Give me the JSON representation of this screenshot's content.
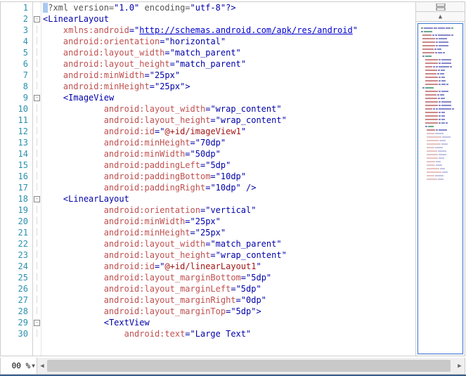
{
  "zoom": "00 %",
  "footer_tip": "",
  "lines": [
    {
      "n": 1,
      "fold": "",
      "ind": 0,
      "tokens": [
        [
          "tag",
          "<"
        ],
        [
          "pi",
          "?xml version="
        ],
        [
          "str",
          "\"1.0\""
        ],
        [
          "pi",
          " encoding="
        ],
        [
          "str",
          "\"utf-8\""
        ],
        [
          "tag",
          "?>"
        ]
      ]
    },
    {
      "n": 2,
      "fold": "box",
      "ind": 0,
      "tokens": [
        [
          "brk",
          "<"
        ],
        [
          "tag",
          "LinearLayout"
        ]
      ]
    },
    {
      "n": 3,
      "fold": "line",
      "ind": 1,
      "tokens": [
        [
          "attr",
          "xmlns:android"
        ],
        [
          "brk",
          "="
        ],
        [
          "str",
          "\""
        ],
        [
          "url",
          "http://schemas.android.com/apk/res/android"
        ],
        [
          "str",
          "\""
        ]
      ]
    },
    {
      "n": 4,
      "fold": "line",
      "ind": 1,
      "tokens": [
        [
          "attr",
          "android:orientation"
        ],
        [
          "brk",
          "="
        ],
        [
          "str",
          "\"horizontal\""
        ]
      ]
    },
    {
      "n": 5,
      "fold": "line",
      "ind": 1,
      "tokens": [
        [
          "attr",
          "android:layout_width"
        ],
        [
          "brk",
          "="
        ],
        [
          "str",
          "\"match_parent\""
        ]
      ]
    },
    {
      "n": 6,
      "fold": "line",
      "ind": 1,
      "tokens": [
        [
          "attr",
          "android:layout_height"
        ],
        [
          "brk",
          "="
        ],
        [
          "str",
          "\"match_parent\""
        ]
      ]
    },
    {
      "n": 7,
      "fold": "line",
      "ind": 1,
      "tokens": [
        [
          "attr",
          "android:minWidth"
        ],
        [
          "brk",
          "="
        ],
        [
          "str",
          "\"25px\""
        ]
      ]
    },
    {
      "n": 8,
      "fold": "line",
      "ind": 1,
      "tokens": [
        [
          "attr",
          "android:minHeight"
        ],
        [
          "brk",
          "="
        ],
        [
          "str",
          "\"25px\""
        ],
        [
          "brk",
          ">"
        ]
      ]
    },
    {
      "n": 9,
      "fold": "box",
      "ind": 1,
      "tokens": [
        [
          "brk",
          "<"
        ],
        [
          "tag",
          "ImageView"
        ]
      ]
    },
    {
      "n": 10,
      "fold": "line",
      "ind": 3,
      "tokens": [
        [
          "attr",
          "android:layout_width"
        ],
        [
          "brk",
          "="
        ],
        [
          "str",
          "\"wrap_content\""
        ]
      ]
    },
    {
      "n": 11,
      "fold": "line",
      "ind": 3,
      "tokens": [
        [
          "attr",
          "android:layout_height"
        ],
        [
          "brk",
          "="
        ],
        [
          "str",
          "\"wrap_content\""
        ]
      ]
    },
    {
      "n": 12,
      "fold": "line",
      "ind": 3,
      "tokens": [
        [
          "attr",
          "android:id"
        ],
        [
          "brk",
          "="
        ],
        [
          "str",
          "\""
        ],
        [
          "id",
          "@+id/imageView1"
        ],
        [
          "str",
          "\""
        ]
      ]
    },
    {
      "n": 13,
      "fold": "line",
      "ind": 3,
      "tokens": [
        [
          "attr",
          "android:minHeight"
        ],
        [
          "brk",
          "="
        ],
        [
          "str",
          "\"70dp\""
        ]
      ]
    },
    {
      "n": 14,
      "fold": "line",
      "ind": 3,
      "tokens": [
        [
          "attr",
          "android:minWidth"
        ],
        [
          "brk",
          "="
        ],
        [
          "str",
          "\"50dp\""
        ]
      ]
    },
    {
      "n": 15,
      "fold": "line",
      "ind": 3,
      "tokens": [
        [
          "attr",
          "android:paddingLeft"
        ],
        [
          "brk",
          "="
        ],
        [
          "str",
          "\"5dp\""
        ]
      ]
    },
    {
      "n": 16,
      "fold": "line",
      "ind": 3,
      "tokens": [
        [
          "attr",
          "android:paddingBottom"
        ],
        [
          "brk",
          "="
        ],
        [
          "str",
          "\"10dp\""
        ]
      ]
    },
    {
      "n": 17,
      "fold": "line",
      "ind": 3,
      "tokens": [
        [
          "attr",
          "android:paddingRight"
        ],
        [
          "brk",
          "="
        ],
        [
          "str",
          "\"10dp\""
        ],
        [
          "brk",
          " />"
        ]
      ]
    },
    {
      "n": 18,
      "fold": "box",
      "ind": 1,
      "tokens": [
        [
          "brk",
          "<"
        ],
        [
          "tag",
          "LinearLayout"
        ]
      ]
    },
    {
      "n": 19,
      "fold": "line",
      "ind": 3,
      "tokens": [
        [
          "attr",
          "android:orientation"
        ],
        [
          "brk",
          "="
        ],
        [
          "str",
          "\"vertical\""
        ]
      ]
    },
    {
      "n": 20,
      "fold": "line",
      "ind": 3,
      "tokens": [
        [
          "attr",
          "android:minWidth"
        ],
        [
          "brk",
          "="
        ],
        [
          "str",
          "\"25px\""
        ]
      ]
    },
    {
      "n": 21,
      "fold": "line",
      "ind": 3,
      "tokens": [
        [
          "attr",
          "android:minHeight"
        ],
        [
          "brk",
          "="
        ],
        [
          "str",
          "\"25px\""
        ]
      ]
    },
    {
      "n": 22,
      "fold": "line",
      "ind": 3,
      "tokens": [
        [
          "attr",
          "android:layout_width"
        ],
        [
          "brk",
          "="
        ],
        [
          "str",
          "\"match_parent\""
        ]
      ]
    },
    {
      "n": 23,
      "fold": "line",
      "ind": 3,
      "tokens": [
        [
          "attr",
          "android:layout_height"
        ],
        [
          "brk",
          "="
        ],
        [
          "str",
          "\"wrap_content\""
        ]
      ]
    },
    {
      "n": 24,
      "fold": "line",
      "ind": 3,
      "tokens": [
        [
          "attr",
          "android:id"
        ],
        [
          "brk",
          "="
        ],
        [
          "str",
          "\""
        ],
        [
          "id",
          "@+id/linearLayout1"
        ],
        [
          "str",
          "\""
        ]
      ]
    },
    {
      "n": 25,
      "fold": "line",
      "ind": 3,
      "tokens": [
        [
          "attr",
          "android:layout_marginBottom"
        ],
        [
          "brk",
          "="
        ],
        [
          "str",
          "\"5dp\""
        ]
      ]
    },
    {
      "n": 26,
      "fold": "line",
      "ind": 3,
      "tokens": [
        [
          "attr",
          "android:layout_marginLeft"
        ],
        [
          "brk",
          "="
        ],
        [
          "str",
          "\"5dp\""
        ]
      ]
    },
    {
      "n": 27,
      "fold": "line",
      "ind": 3,
      "tokens": [
        [
          "attr",
          "android:layout_marginRight"
        ],
        [
          "brk",
          "="
        ],
        [
          "str",
          "\"0dp\""
        ]
      ]
    },
    {
      "n": 28,
      "fold": "line",
      "ind": 3,
      "tokens": [
        [
          "attr",
          "android:layout_marginTop"
        ],
        [
          "brk",
          "="
        ],
        [
          "str",
          "\"5dp\""
        ],
        [
          "brk",
          ">"
        ]
      ]
    },
    {
      "n": 29,
      "fold": "box",
      "ind": 3,
      "tokens": [
        [
          "brk",
          "<"
        ],
        [
          "tag",
          "TextView"
        ]
      ]
    },
    {
      "n": 30,
      "fold": "line",
      "ind": 4,
      "tokens": [
        [
          "attr",
          "android:text"
        ],
        [
          "brk",
          "="
        ],
        [
          "str",
          "\"Large Text\""
        ]
      ]
    }
  ]
}
